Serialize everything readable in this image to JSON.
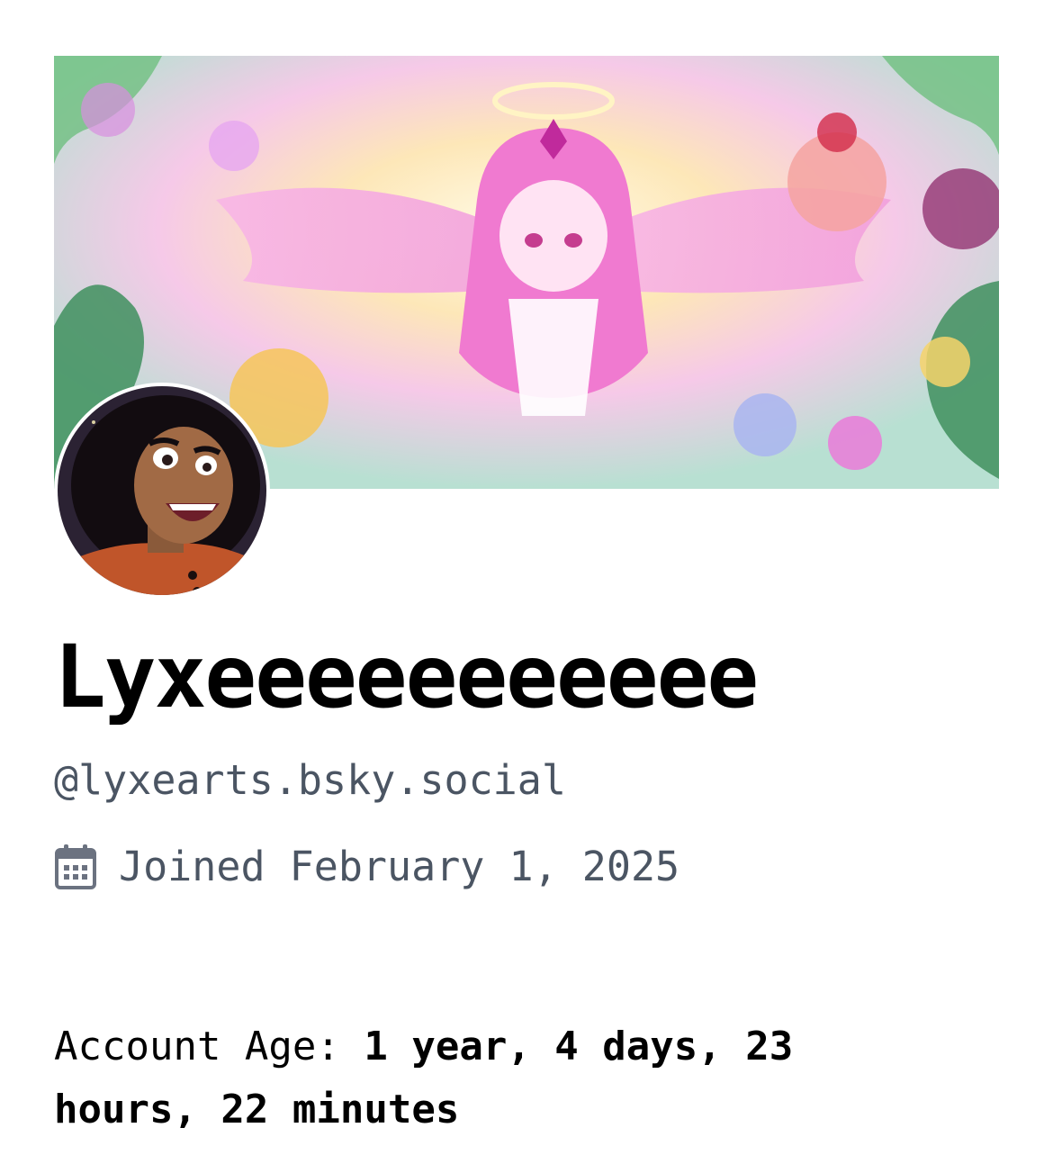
{
  "profile": {
    "display_name": "Lyxeeeeeeeeeee",
    "handle": "@lyxearts.bsky.social",
    "joined_label": "Joined February 1, 2025",
    "banner_icon": "illustrated-banner-image",
    "avatar_icon": "illustrated-avatar-image"
  },
  "account_age": {
    "label": "Account Age: ",
    "value": "1 year, 4 days, 23 hours, 22 minutes"
  },
  "colors": {
    "muted_text": "#4b5563",
    "text": "#000000",
    "background": "#ffffff",
    "icon": "#6b7280"
  },
  "icons": {
    "calendar": "calendar-icon"
  }
}
